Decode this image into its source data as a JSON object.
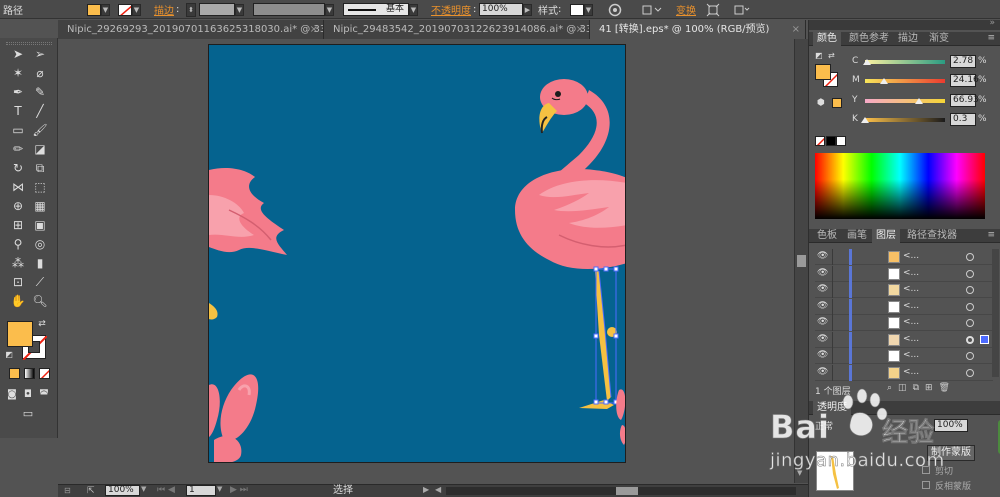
{
  "control_bar": {
    "object_type": "路径",
    "fill_color": "#fbbd4c",
    "stroke_label": "描边",
    "stroke_style": "基本",
    "opacity_label": "不透明度",
    "opacity_value": "100%",
    "style_label": "样式",
    "transform_label": "变换"
  },
  "tabs": [
    {
      "label": "Nipic_29269293_20190701163625318030.ai* @ 33...",
      "close": "×"
    },
    {
      "label": "Nipic_29483542_20190703122623914086.ai* @ 33...",
      "close": "×"
    },
    {
      "label": "41 [转换].eps* @ 100% (RGB/预览)",
      "close": "×"
    }
  ],
  "status_bar": {
    "zoom": "100%",
    "page": "1",
    "tool": "选择"
  },
  "color_panel": {
    "tabs": [
      "颜色",
      "颜色参考",
      "描边",
      "渐变"
    ],
    "channels": [
      {
        "label": "C",
        "value": "2.78",
        "unit": "%",
        "track": "linear-gradient(90deg,#fdf2a0,#2a9b82)",
        "level": 0.03
      },
      {
        "label": "M",
        "value": "24.16",
        "unit": "%",
        "track": "linear-gradient(90deg,#f7e65a,#ec3b2f)",
        "level": 0.24
      },
      {
        "label": "Y",
        "value": "66.93",
        "unit": "%",
        "track": "linear-gradient(90deg,#f6a9c8,#f5d536)",
        "level": 0.67
      },
      {
        "label": "K",
        "value": "0.3",
        "unit": "%",
        "track": "linear-gradient(90deg,#fbc04a,#1b1b1b)",
        "level": 0.003
      }
    ],
    "fill_color": "#fbbd4c"
  },
  "layers_panel": {
    "tabs": [
      "色板",
      "画笔",
      "图层",
      "路径查找器"
    ],
    "rows": [
      {
        "name": "<...",
        "thumb_color": "#f7c066"
      },
      {
        "name": "<...",
        "thumb_color": "#ffffff"
      },
      {
        "name": "<...",
        "thumb_color": "#f2d8a0"
      },
      {
        "name": "<...",
        "thumb_color": "#ffffff"
      },
      {
        "name": "<...",
        "thumb_color": "#ffffff"
      },
      {
        "name": "<...",
        "thumb_color": "#f0d7b0"
      },
      {
        "name": "<...",
        "thumb_color": "#ffffff"
      },
      {
        "name": "<...",
        "thumb_color": "#f3d28a"
      }
    ],
    "layer_count": "1 个图层"
  },
  "transparency_panel": {
    "title": "透明度",
    "blend_mode": "正常",
    "opacity": "100%",
    "make_mask": "制作蒙版",
    "clip": "剪切",
    "invert_mask": "反相蒙版"
  },
  "watermark": {
    "brand": "Bai",
    "brand2": "经验",
    "url": "jingyan.baidu.com"
  },
  "colors": {
    "artboard": "#05638f",
    "flamingo_pink": "#f47b8a",
    "flamingo_light": "#f8a1ac",
    "beak_yellow": "#f5c142",
    "selection_blue": "#4d6bff"
  }
}
